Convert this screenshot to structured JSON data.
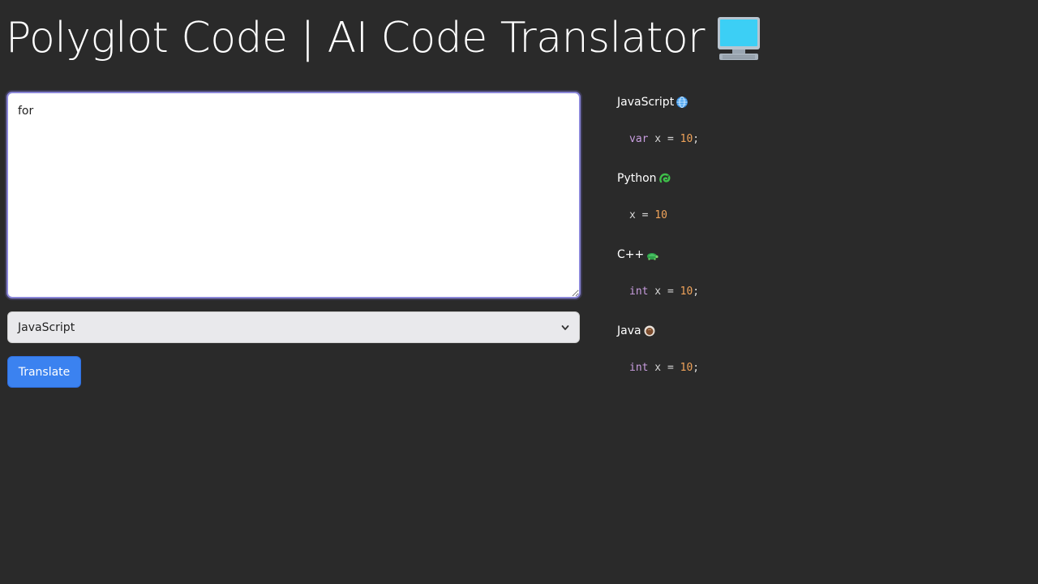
{
  "header": {
    "title": "Polyglot Code | AI Code Translator",
    "icon": "computer-icon"
  },
  "editor": {
    "value": "for"
  },
  "language_select": {
    "selected": "JavaScript",
    "icon": "chevron-down-icon"
  },
  "actions": {
    "translate_label": "Translate"
  },
  "colors": {
    "background": "#2a2a2a",
    "button": "#3b82f0",
    "keyword": "#c99ee0",
    "number": "#f0a35a"
  },
  "results": [
    {
      "name": "JavaScript",
      "icon": "globe-icon",
      "code": {
        "keyword": "var",
        "rest": " x = ",
        "number": "10",
        "end": ";"
      }
    },
    {
      "name": "Python",
      "icon": "snake-icon",
      "code": {
        "keyword": "",
        "rest": "x = ",
        "number": "10",
        "end": ""
      }
    },
    {
      "name": "C++",
      "icon": "turtle-icon",
      "code": {
        "keyword": "int",
        "rest": " x = ",
        "number": "10",
        "end": ";"
      }
    },
    {
      "name": "Java",
      "icon": "coffee-icon",
      "code": {
        "keyword": "int",
        "rest": " x = ",
        "number": "10",
        "end": ";"
      }
    }
  ]
}
